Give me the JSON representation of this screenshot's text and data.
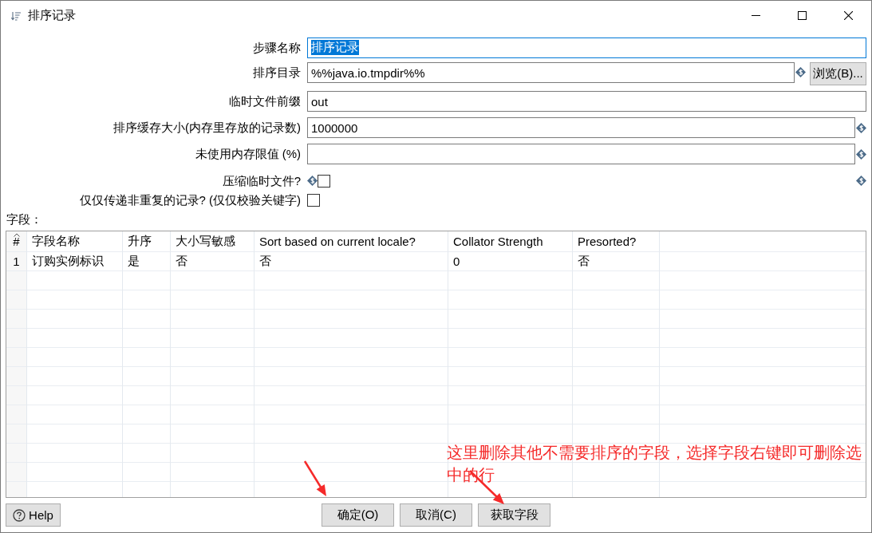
{
  "window": {
    "title": "排序记录"
  },
  "form": [
    {
      "kind": "text",
      "label": "步骤名称",
      "value": "排序记录",
      "focused": true,
      "variable": false
    },
    {
      "kind": "text",
      "label": "排序目录",
      "value": "%%java.io.tmpdir%%",
      "focused": false,
      "variable": true,
      "button": "浏览(B)..."
    },
    {
      "kind": "text",
      "label": "临时文件前缀",
      "value": "out",
      "focused": false,
      "variable": false
    },
    {
      "kind": "text",
      "label": "排序缓存大小(内存里存放的记录数)",
      "value": "1000000",
      "focused": false,
      "variable": true
    },
    {
      "kind": "text",
      "label": "未使用内存限值 (%)",
      "focused": false,
      "variable": true
    },
    {
      "kind": "checkbox",
      "label": "压缩临时文件?",
      "checked": false,
      "variable": true
    },
    {
      "kind": "checkbox",
      "label": "仅仅传递非重复的记录? (仅仅校验关键字)",
      "checked": false,
      "variable": false
    }
  ],
  "fields": {
    "label": "字段：",
    "table": {
      "columns": [
        {
          "label": "#",
          "sorted": true
        },
        {
          "label": "字段名称",
          "sorted": false
        },
        {
          "label": "升序",
          "sorted": false
        },
        {
          "label": "大小写敏感",
          "sorted": false
        },
        {
          "label": "Sort based on current locale?",
          "sorted": false
        },
        {
          "label": "Collator Strength",
          "sorted": false
        },
        {
          "label": "Presorted?",
          "sorted": false
        }
      ],
      "rows": [
        [
          "1",
          "订购实例标识",
          "是",
          "否",
          "否",
          "0",
          "否"
        ]
      ]
    }
  },
  "buttons": [
    {
      "kind": "help",
      "label": "Help"
    },
    {
      "kind": "confirm",
      "label": "确定(O)"
    },
    {
      "kind": "cancel",
      "label": "取消(C)"
    },
    {
      "kind": "action",
      "label": "获取字段"
    }
  ],
  "annotation": {
    "text": "这里删除其他不需要排序的字段，选择字段右键即可删除选中的行"
  }
}
